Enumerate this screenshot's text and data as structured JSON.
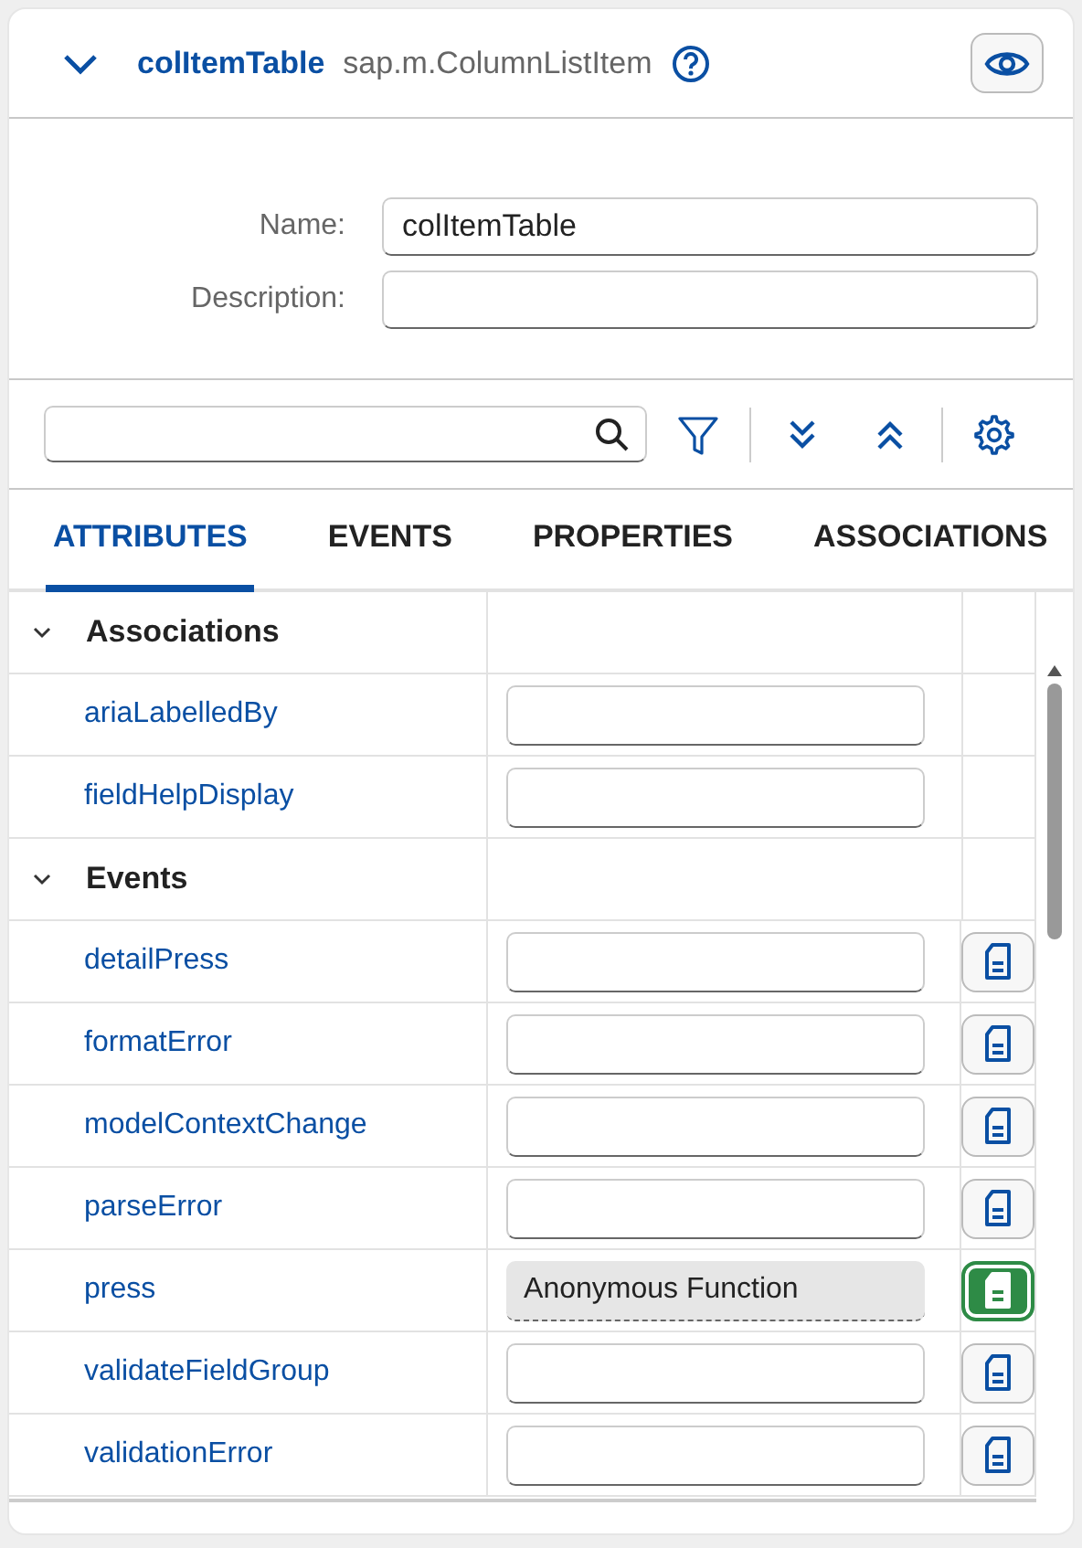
{
  "header": {
    "expanded": true,
    "control_id": "colItemTable",
    "control_type": "sap.m.ColumnListItem"
  },
  "form": [
    {
      "label": "Name:",
      "value": "colItemTable"
    },
    {
      "label": "Description:"
    }
  ],
  "tabs": [
    {
      "label": "ATTRIBUTES",
      "selected": true
    },
    {
      "label": "EVENTS",
      "selected": false
    },
    {
      "label": "PROPERTIES",
      "selected": false
    },
    {
      "label": "ASSOCIATIONS",
      "selected": false
    }
  ],
  "groups": [
    {
      "label": "Associations",
      "expanded": true,
      "children": [
        {
          "name": "ariaLabelledBy",
          "readonly": false
        },
        {
          "name": "fieldHelpDisplay",
          "readonly": false
        }
      ]
    },
    {
      "label": "Events",
      "expanded": true,
      "children": [
        {
          "name": "detailPress",
          "readonly": false,
          "attached": false
        },
        {
          "name": "formatError",
          "readonly": false,
          "attached": false
        },
        {
          "name": "modelContextChange",
          "readonly": false,
          "attached": false
        },
        {
          "name": "parseError",
          "readonly": false,
          "attached": false
        },
        {
          "name": "press",
          "readonly": true,
          "value": "Anonymous Function",
          "attached": true
        },
        {
          "name": "validateFieldGroup",
          "readonly": false,
          "attached": false
        },
        {
          "name": "validationError",
          "readonly": false,
          "attached": false
        }
      ]
    }
  ]
}
